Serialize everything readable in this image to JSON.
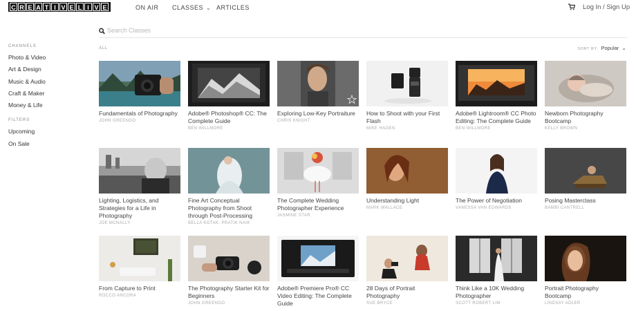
{
  "header": {
    "logo_letters": [
      "C",
      "R",
      "E",
      "A",
      "T",
      "I",
      "V",
      "E",
      "L",
      "I",
      "V",
      "E"
    ],
    "nav": {
      "on_air": "ON AIR",
      "classes": "CLASSES",
      "articles": "ARTICLES"
    },
    "login": "Log In / Sign Up"
  },
  "sidebar": {
    "channels_heading": "CHANNELS",
    "channels": [
      "Photo & Video",
      "Art & Design",
      "Music & Audio",
      "Craft & Maker",
      "Money & Life"
    ],
    "filters_heading": "FILTERS",
    "filters": [
      "Upcoming",
      "On Sale"
    ]
  },
  "search": {
    "placeholder": "Search Classes"
  },
  "toolbar": {
    "filter_all": "ALL",
    "sort_label": "SORT BY:",
    "sort_value": "Popular"
  },
  "classes": [
    {
      "title": "Fundamentals of Photography",
      "author": "JOHN GREENGO",
      "star": false
    },
    {
      "title": "Adobe® Photoshop® CC: The Complete Guide",
      "author": "BEN WILLMORE",
      "star": false
    },
    {
      "title": "Exploring Low-Key Portraiture",
      "author": "CHRIS KNIGHT",
      "star": true
    },
    {
      "title": "How to Shoot with your First Flash",
      "author": "MIKE HAGEN",
      "star": false
    },
    {
      "title": "Adobe® Lightroom® CC Photo Editing: The Complete Guide",
      "author": "BEN WILLMORE",
      "star": false
    },
    {
      "title": "Newborn Photography Bootcamp",
      "author": "KELLY BROWN",
      "star": false
    },
    {
      "title": "Lighting, Logistics, and Strategies for a Life in Photography",
      "author": "JOE MCNALLY",
      "star": false
    },
    {
      "title": "Fine Art Conceptual Photography from Shoot through Post-Processing",
      "author": "BELLA KOTAK, PRATIK NAIK",
      "star": false
    },
    {
      "title": "The Complete Wedding Photographer Experience",
      "author": "JASMINE STAR",
      "star": false
    },
    {
      "title": "Understanding Light",
      "author": "MARK WALLACE",
      "star": false
    },
    {
      "title": "The Power of Negotiation",
      "author": "VANESSA VAN EDWARDS",
      "star": false
    },
    {
      "title": "Posing Masterclass",
      "author": "BAMBI CANTRELL",
      "star": false
    },
    {
      "title": "From Capture to Print",
      "author": "ROCCO ANCORA",
      "star": false
    },
    {
      "title": "The Photography Starter Kit for Beginners",
      "author": "JOHN GREENGO",
      "star": false
    },
    {
      "title": "Adobe® Premiere Pro® CC Video Editing: The Complete Guide",
      "author": "",
      "star": false
    },
    {
      "title": "28 Days of Portrait Photography",
      "author": "SUE BRYCE",
      "star": false
    },
    {
      "title": "Think Like a 10K Wedding Photographer",
      "author": "SCOTT ROBERT LIM",
      "star": false
    },
    {
      "title": "Portrait Photography Bootcamp",
      "author": "LINDSAY ADLER",
      "star": false
    }
  ],
  "icons": {
    "search": "search-icon",
    "cart": "cart-icon",
    "chevron": "chevron-down-icon",
    "star": "star-icon"
  },
  "colors": {
    "logo_bg": "#111111",
    "text": "#444444",
    "muted": "#aaaaaa"
  }
}
